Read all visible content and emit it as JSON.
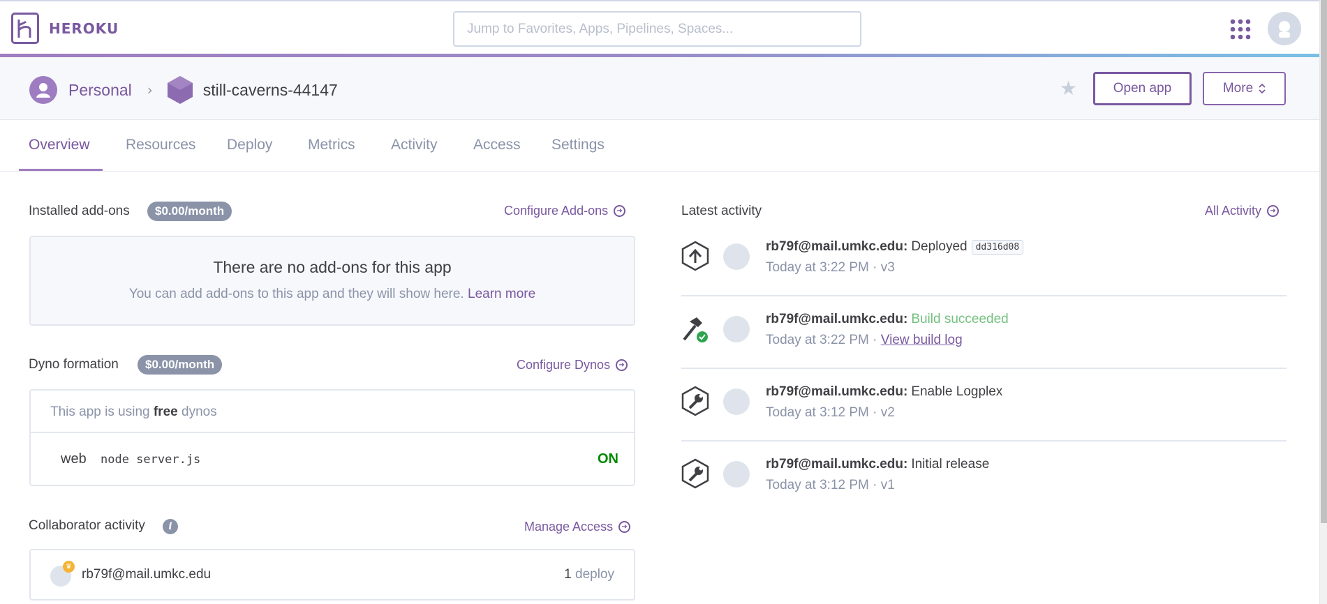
{
  "topbar": {
    "brand": "HEROKU",
    "search_placeholder": "Jump to Favorites, Apps, Pipelines, Spaces..."
  },
  "breadcrumb": {
    "account": "Personal",
    "app_name": "still-caverns-44147"
  },
  "actions": {
    "open_app": "Open app",
    "more": "More"
  },
  "tabs": [
    "Overview",
    "Resources",
    "Deploy",
    "Metrics",
    "Activity",
    "Access",
    "Settings"
  ],
  "active_tab": "Overview",
  "addons": {
    "title": "Installed add-ons",
    "price": "$0.00/month",
    "configure": "Configure Add-ons",
    "empty_title": "There are no add-ons for this app",
    "empty_text": "You can add add-ons to this app and they will show here.",
    "learn_more": "Learn more"
  },
  "dynos": {
    "title": "Dyno formation",
    "price": "$0.00/month",
    "configure": "Configure Dynos",
    "using_prefix": "This app is using",
    "using_type": "free",
    "using_suffix": "dynos",
    "process": "web",
    "command": "node server.js",
    "state": "ON"
  },
  "collaborators": {
    "title": "Collaborator activity",
    "manage": "Manage Access",
    "email": "rb79f@mail.umkc.edu",
    "deploy_count": "1",
    "deploy_label": "deploy"
  },
  "activity": {
    "title": "Latest activity",
    "all_link": "All Activity",
    "items": [
      {
        "user": "rb79f@mail.umkc.edu:",
        "action": "Deployed",
        "hash": "dd316d08",
        "time": "Today at 3:22 PM",
        "meta": "· v3",
        "icon": "deploy-icon"
      },
      {
        "user": "rb79f@mail.umkc.edu:",
        "action": "Build succeeded",
        "time": "Today at 3:22 PM",
        "meta": "·",
        "link": "View build log",
        "icon": "build-icon"
      },
      {
        "user": "rb79f@mail.umkc.edu:",
        "action": "Enable Logplex",
        "time": "Today at 3:12 PM",
        "meta": "· v2",
        "icon": "wrench-icon"
      },
      {
        "user": "rb79f@mail.umkc.edu:",
        "action": "Initial release",
        "time": "Today at 3:12 PM",
        "meta": "· v1",
        "icon": "wrench-icon"
      }
    ]
  },
  "colors": {
    "brand": "#79589f",
    "muted": "#8a93a8",
    "success": "#74c080",
    "dyno_on": "#008a00"
  }
}
